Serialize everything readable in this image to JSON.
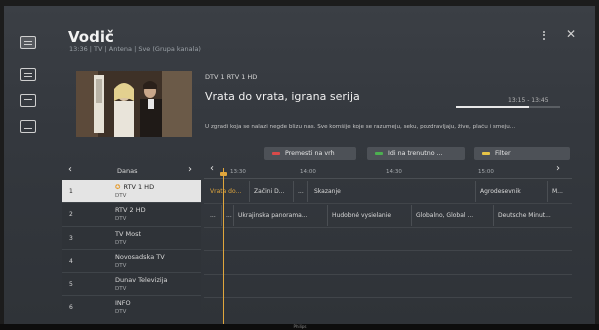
{
  "header": {
    "title": "Vodič",
    "subtitle": "13:36 | TV | Antena | Sve (Grupa kanala)"
  },
  "icons": {
    "rail": [
      "tv-guide-icon",
      "list-icon",
      "recording-icon",
      "schedule-icon"
    ],
    "more": "more-vertical-icon",
    "close": "close-icon"
  },
  "detail": {
    "channel": "DTV 1 RTV 1 HD",
    "title": "Vrata do vrata, igrana serija",
    "time": "13:15 - 13:45",
    "progress": 0.7,
    "description": "U zgradi koja se nalazi negde blizu nas. Sve komšije koje se razumeju, seku, pozdravljaju, žive, plaču i smeju..."
  },
  "buttons": {
    "record": "Premesti na vrh",
    "watch": "Idi na trenutno ...",
    "filter": "Filter"
  },
  "colors": {
    "record_dot": "#d94a4a",
    "watch_dot": "#4caf50",
    "filter_dot": "#e8c547",
    "now_indicator": "#e0a63c"
  },
  "day": {
    "label": "Danas"
  },
  "timeline": {
    "ticks": [
      "13:30",
      "14:00",
      "14:30",
      "15:00"
    ]
  },
  "channels": [
    {
      "num": "1",
      "name": "RTV 1 HD",
      "sub": "DTV",
      "favorite": true
    },
    {
      "num": "2",
      "name": "RTV 2 HD",
      "sub": "DTV",
      "favorite": false
    },
    {
      "num": "3",
      "name": "TV Most",
      "sub": "DTV",
      "favorite": false
    },
    {
      "num": "4",
      "name": "Novosadska TV",
      "sub": "DTV",
      "favorite": false
    },
    {
      "num": "5",
      "name": "Dunav Televizija",
      "sub": "DTV",
      "favorite": false
    },
    {
      "num": "6",
      "name": "INFO",
      "sub": "DTV",
      "favorite": false
    }
  ],
  "programs": {
    "row1": [
      "Vrata do...",
      "Začini D...",
      "...",
      "Skazanje",
      "Agrodesevnik",
      "M..."
    ],
    "row2": [
      "...",
      "...",
      "Ukrajinska panorama...",
      "Hudobné vysielanie",
      "Globalno, Global ...",
      "Deutsche Minut..."
    ]
  },
  "brand": "Philips"
}
